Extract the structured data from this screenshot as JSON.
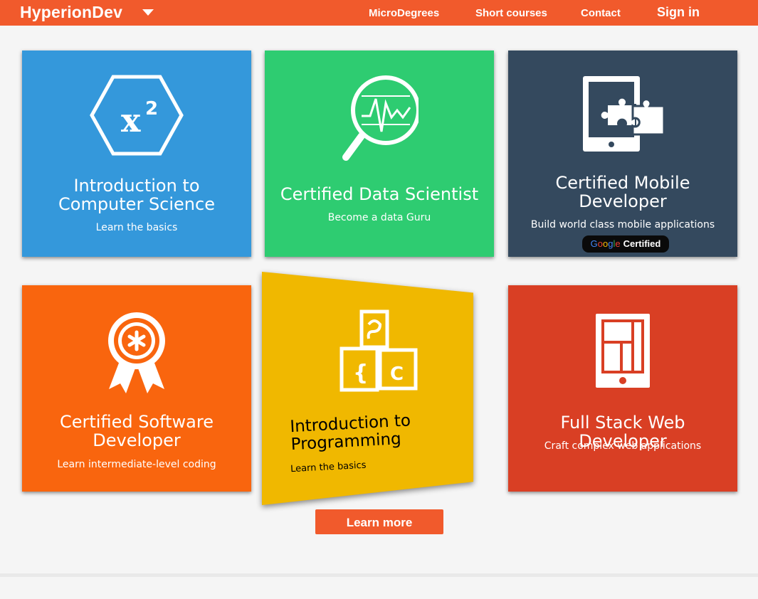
{
  "navbar": {
    "brand": "HyperionDev",
    "brand_menu_icon": "chevron-down-icon",
    "links": [
      "MicroDegrees",
      "Short courses",
      "Contact"
    ],
    "sign_in": "Sign in",
    "color": "#f15a2c"
  },
  "cards": [
    {
      "title": "Introduction to Computer Science",
      "subtitle": "Learn the basics",
      "icon": "x-squared-hexagon-icon",
      "color": "#3498db"
    },
    {
      "title": "Certified Data Scientist",
      "subtitle": "Become a data Guru",
      "icon": "magnifier-chart-icon",
      "color": "#2ecc71"
    },
    {
      "title": "Certified Mobile Developer",
      "subtitle": "Build world class mobile applications",
      "icon": "tablet-puzzle-icon",
      "color": "#34495e",
      "badge": {
        "brand": "Google",
        "label": "Certified"
      }
    },
    {
      "title": "Certified Software Developer",
      "subtitle": "Learn intermediate-level coding",
      "icon": "award-ribbon-icon",
      "color": "#f9650e"
    },
    {
      "title": "Introduction to Programming",
      "subtitle": "Learn the basics",
      "icon": "code-blocks-icon",
      "color": "#f0b800"
    },
    {
      "title": "Full Stack Web Developer",
      "subtitle": "Craft complex web applications",
      "icon": "tablet-layout-icon",
      "color": "#d93f24"
    }
  ],
  "cta": {
    "label": "Learn more"
  }
}
